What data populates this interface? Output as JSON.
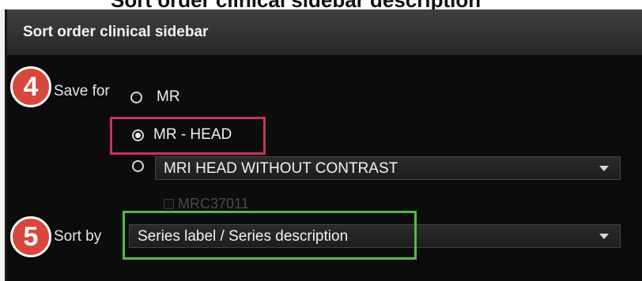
{
  "page_heading_cut": "Sort order clinical sidebar description",
  "window": {
    "title": "Sort order clinical sidebar"
  },
  "steps": {
    "save_for": "4",
    "sort_by": "5"
  },
  "save_for": {
    "label": "Save for",
    "options": [
      {
        "label": "MR",
        "selected": false
      },
      {
        "label": "MR - HEAD",
        "selected": true
      },
      {
        "label": "",
        "selected": false
      }
    ],
    "protocol_dropdown": {
      "value": "MRI HEAD WITHOUT CONTRAST"
    },
    "protocol_code": {
      "label": "MRC37011",
      "checked": false,
      "disabled": true
    }
  },
  "sort_by": {
    "label": "Sort by",
    "value": "Series label / Series description"
  },
  "colors": {
    "step_badge": "#d7473d",
    "highlight_red": "#c5355b",
    "highlight_green": "#55b947",
    "dialog_bg": "#0c0c0c"
  }
}
